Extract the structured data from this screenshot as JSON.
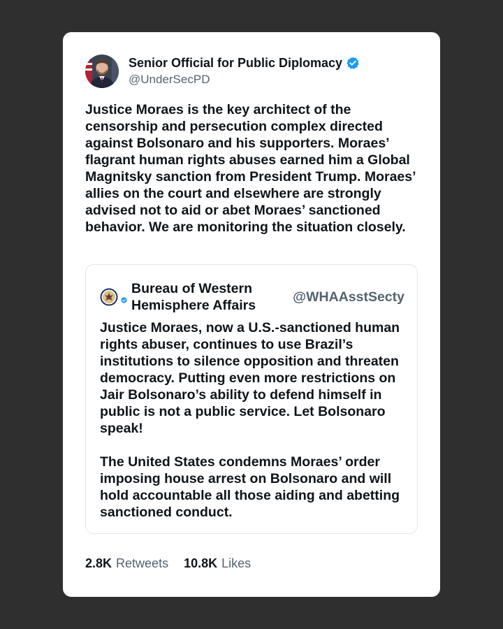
{
  "author": {
    "display_name": "Senior Official for Public Diplomacy",
    "handle": "@UnderSecPD",
    "verified_icon": "verified-badge-icon",
    "avatar_icon": "avatar-photo"
  },
  "tweet": {
    "text": "Justice Moraes is the key architect of the censorship and persecution complex directed against Bolsonaro and his supporters. Moraes’ flagrant human rights abuses earned him a Global Magnitsky sanction from President Trump. Moraes’ allies on the court and elsewhere are strongly advised not to aid or abet Moraes’ sanctioned behavior. We are monitoring the situation closely."
  },
  "quoted_tweet": {
    "display_name": "Bureau of Western Hemisphere Affairs",
    "handle": "@WHAAsstSecty",
    "seal_icon": "state-department-seal-icon",
    "paragraph_1": "Justice Moraes, now a U.S.-sanctioned human rights abuser, continues to use Brazil’s institutions to silence opposition and threaten democracy.  Putting even more restrictions on Jair Bolsonaro’s ability to defend himself in public is not a public service. Let Bolsonaro speak!",
    "paragraph_2": "The United States condemns Moraes’ order imposing house arrest on Bolsonaro and will hold accountable all those aiding and abetting sanctioned conduct."
  },
  "stats": {
    "retweets_count": "2.8K",
    "retweets_label": "Retweets",
    "likes_count": "10.8K",
    "likes_label": "Likes"
  },
  "colors": {
    "background": "#2f2f2f",
    "card": "#ffffff",
    "text": "#0f1419",
    "secondary": "#536471",
    "verified": "#1d9bf0"
  }
}
